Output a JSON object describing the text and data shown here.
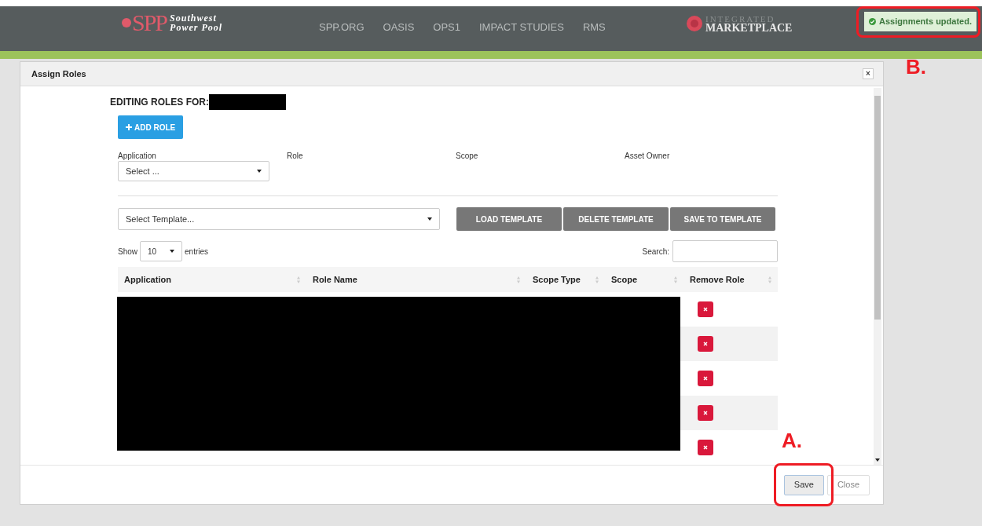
{
  "header": {
    "logo": {
      "mark": "SPP",
      "line1": "Southwest",
      "line2": "Power Pool"
    },
    "nav": [
      "SPP.ORG",
      "OASIS",
      "OPS1",
      "IMPACT STUDIES",
      "RMS"
    ],
    "brand": {
      "line1": "INTEGRATED",
      "line2": "MARKETPLACE"
    },
    "toast": {
      "text": "Assignments updated.",
      "kind": "success"
    }
  },
  "modal": {
    "title": "Assign Roles",
    "close": "×",
    "heading": "EDITING ROLES FOR:",
    "heading_redacted": true,
    "add_button": "ADD ROLE",
    "fields": [
      {
        "label": "Application",
        "kind": "select",
        "placeholder": "Select ..."
      },
      {
        "label": "Role",
        "kind": "empty"
      },
      {
        "label": "Scope",
        "kind": "empty"
      },
      {
        "label": "Asset Owner",
        "kind": "empty"
      }
    ],
    "template_select": "Select Template...",
    "template_buttons": [
      "LOAD TEMPLATE",
      "DELETE TEMPLATE",
      "SAVE TO TEMPLATE"
    ],
    "length": {
      "before": "Show",
      "value": "10",
      "after": "entries"
    },
    "search_label": "Search:",
    "table": {
      "columns": [
        "Application",
        "Role Name",
        "Scope Type",
        "Scope",
        "Remove Role"
      ],
      "rows": [
        {
          "kind": "redacted"
        },
        {
          "kind": "redacted"
        },
        {
          "kind": "redacted"
        },
        {
          "kind": "redacted"
        },
        {
          "kind": "redacted"
        }
      ]
    },
    "footer_buttons": [
      {
        "label": "Save",
        "selected": true
      },
      {
        "label": "Close",
        "selected": false
      }
    ]
  },
  "annotations": [
    {
      "label": "A."
    },
    {
      "label": "B."
    }
  ]
}
